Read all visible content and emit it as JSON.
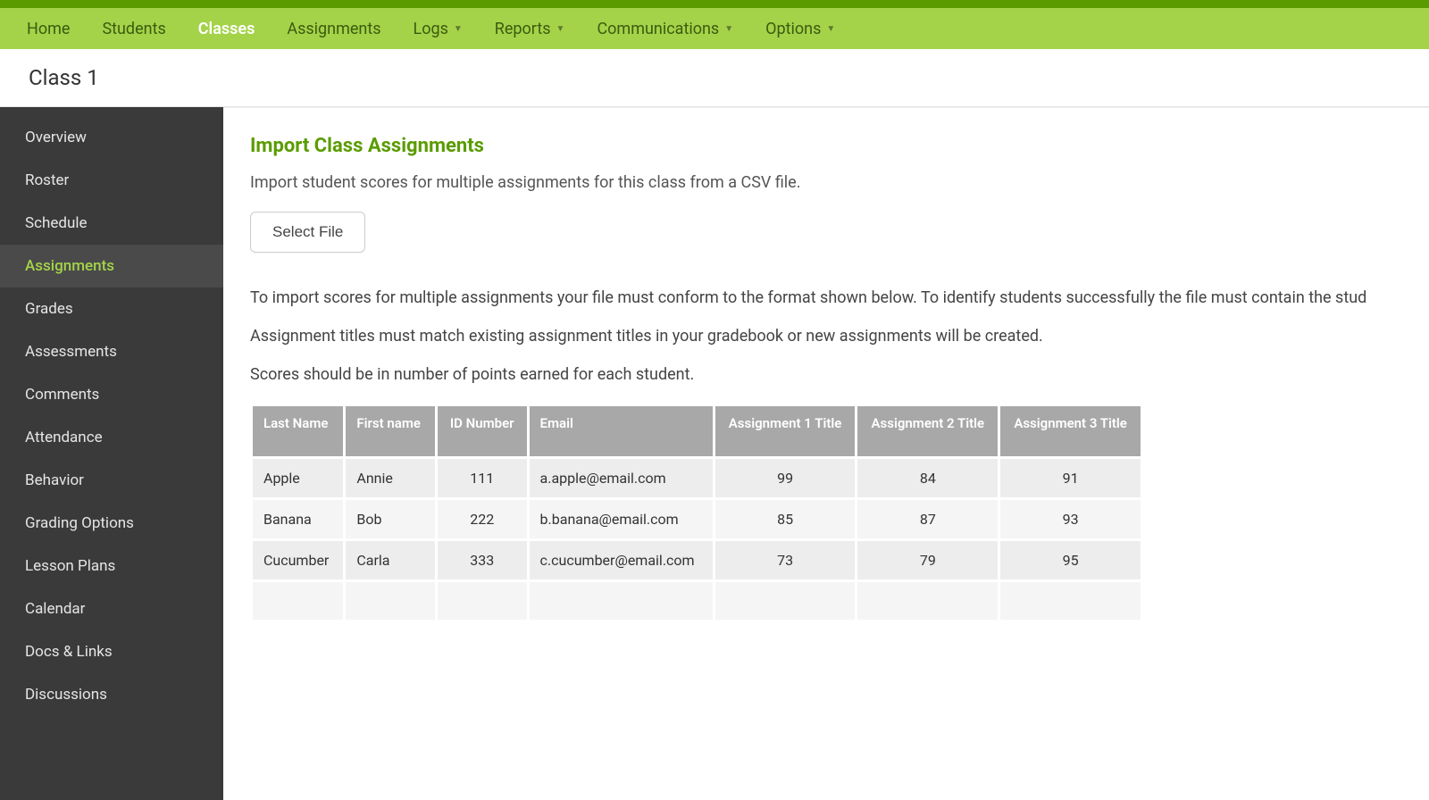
{
  "nav": {
    "items": [
      {
        "label": "Home",
        "dropdown": false
      },
      {
        "label": "Students",
        "dropdown": false
      },
      {
        "label": "Classes",
        "dropdown": false,
        "active": true
      },
      {
        "label": "Assignments",
        "dropdown": false
      },
      {
        "label": "Logs",
        "dropdown": true
      },
      {
        "label": "Reports",
        "dropdown": true
      },
      {
        "label": "Communications",
        "dropdown": true
      },
      {
        "label": "Options",
        "dropdown": true
      }
    ]
  },
  "page": {
    "title": "Class 1"
  },
  "sidebar": {
    "items": [
      {
        "label": "Overview"
      },
      {
        "label": "Roster"
      },
      {
        "label": "Schedule"
      },
      {
        "label": "Assignments",
        "active": true
      },
      {
        "label": "Grades"
      },
      {
        "label": "Assessments"
      },
      {
        "label": "Comments"
      },
      {
        "label": "Attendance"
      },
      {
        "label": "Behavior"
      },
      {
        "label": "Grading Options"
      },
      {
        "label": "Lesson Plans"
      },
      {
        "label": "Calendar"
      },
      {
        "label": "Docs & Links"
      },
      {
        "label": "Discussions"
      }
    ]
  },
  "main": {
    "heading": "Import Class Assignments",
    "intro": "Import student scores for multiple assignments for this class from a CSV file.",
    "select_file_label": "Select File",
    "para1": "To import scores for multiple assignments your file must conform to the format shown below. To identify students successfully the file must contain the stud",
    "para2": "Assignment titles must match existing assignment titles in your gradebook or new assignments will be created.",
    "para3": "Scores should be in number of points earned for each student.",
    "table": {
      "headers": [
        "Last Name",
        "First name",
        "ID Number",
        "Email",
        "Assignment 1 Title",
        "Assignment 2 Title",
        "Assignment 3 Title"
      ],
      "rows": [
        {
          "last": "Apple",
          "first": "Annie",
          "id": "111",
          "email": "a.apple@email.com",
          "a1": "99",
          "a2": "84",
          "a3": "91"
        },
        {
          "last": "Banana",
          "first": "Bob",
          "id": "222",
          "email": "b.banana@email.com",
          "a1": "85",
          "a2": "87",
          "a3": "93"
        },
        {
          "last": "Cucumber",
          "first": "Carla",
          "id": "333",
          "email": "c.cucumber@email.com",
          "a1": "73",
          "a2": "79",
          "a3": "95"
        }
      ]
    }
  }
}
